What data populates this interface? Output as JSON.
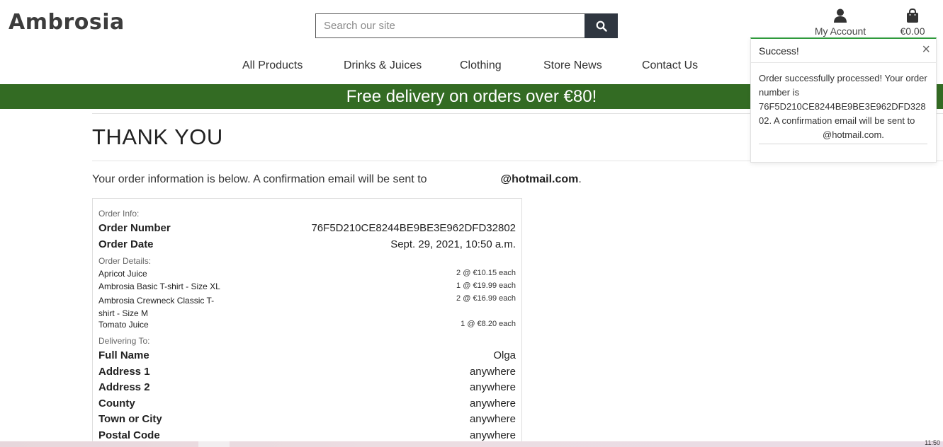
{
  "header": {
    "logo": "Ambrosia",
    "search_placeholder": "Search our site",
    "account_label": "My Account",
    "bag_total": "€0.00"
  },
  "nav": {
    "items": [
      "All Products",
      "Drinks & Juices",
      "Clothing",
      "Store News",
      "Contact Us"
    ]
  },
  "banner": "Free delivery on orders over €80!",
  "page": {
    "title": "THANK YOU",
    "intro_prefix": "Your order information is below. A confirmation email will be sent to",
    "intro_email": "@hotmail.com",
    "intro_suffix": "."
  },
  "order": {
    "order_info_label": "Order Info:",
    "order_number_label": "Order Number",
    "order_number": "76F5D210CE8244BE9BE3E962DFD32802",
    "order_date_label": "Order Date",
    "order_date": "Sept. 29, 2021, 10:50 a.m.",
    "details_label": "Order Details:",
    "items": [
      {
        "name": "Apricot Juice",
        "qty": "2 @ €10.15 each"
      },
      {
        "name": "Ambrosia Basic T-shirt - Size XL",
        "qty": "1 @ €19.99 each"
      },
      {
        "name": "Ambrosia Crewneck Classic T-shirt - Size M",
        "qty": "2 @ €16.99 each"
      },
      {
        "name": "Tomato Juice",
        "qty": "1 @ €8.20 each"
      }
    ],
    "delivering_label": "Delivering To:",
    "delivery": [
      {
        "label": "Full Name",
        "value": "Olga"
      },
      {
        "label": "Address 1",
        "value": "anywhere"
      },
      {
        "label": "Address 2",
        "value": "anywhere"
      },
      {
        "label": "County",
        "value": "anywhere"
      },
      {
        "label": "Town or City",
        "value": "anywhere"
      },
      {
        "label": "Postal Code",
        "value": "anywhere"
      }
    ]
  },
  "toast": {
    "title": "Success!",
    "close": "×",
    "message_1": "Order successfully processed! Your order number is 76F5D210CE8244BE9BE3E962DFD32802. A confirmation email will be sent to",
    "email": "@hotmail.com."
  },
  "taskbar": {
    "clock": "11:50"
  },
  "colors": {
    "banner": "#336b23",
    "toast_accent": "#2e9a3b",
    "search_button": "#2f3640"
  }
}
